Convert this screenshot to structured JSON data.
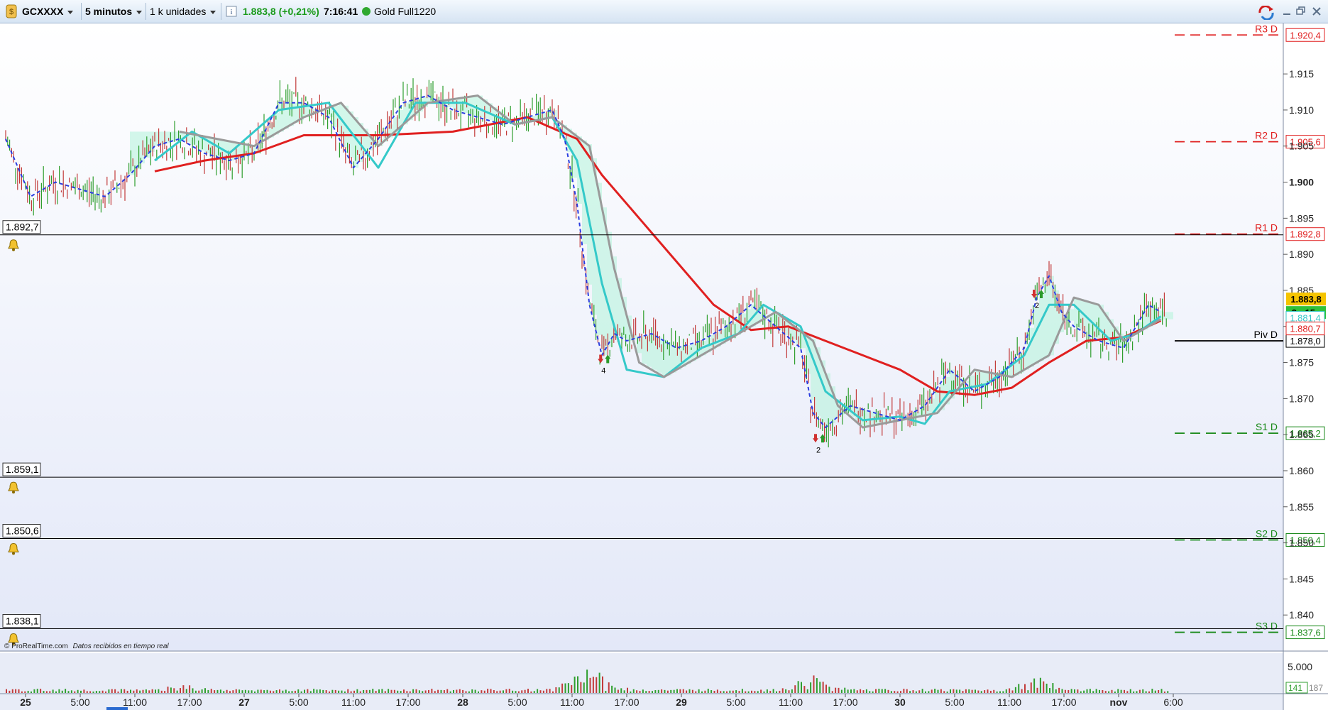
{
  "toolbar": {
    "symbol": "GCXXXX",
    "timeframe": "5 minutos",
    "units": "1 k unidades",
    "info_icon": "info-icon",
    "price_change": "1.883,8 (+0,21%)",
    "time": "7:16:41",
    "status_dot_color": "#2fa82f",
    "instrument_name": "Gold Full1220",
    "window_buttons": [
      "sync-icon",
      "minimize-icon",
      "restore-icon",
      "close-icon"
    ]
  },
  "price_axis": {
    "ticks": [
      {
        "value": 1915,
        "label": "1.915"
      },
      {
        "value": 1910,
        "label": "1.910"
      },
      {
        "value": 1905,
        "label": "1.905"
      },
      {
        "value": 1900,
        "label": "1.900"
      },
      {
        "value": 1895,
        "label": "1.895"
      },
      {
        "value": 1890,
        "label": "1.890"
      },
      {
        "value": 1885,
        "label": "1.885"
      },
      {
        "value": 1880,
        "label": "1.880"
      },
      {
        "value": 1875,
        "label": "1.875"
      },
      {
        "value": 1870,
        "label": "1.870"
      },
      {
        "value": 1865,
        "label": "1.865"
      },
      {
        "value": 1860,
        "label": "1.860"
      },
      {
        "value": 1855,
        "label": "1.855"
      },
      {
        "value": 1850,
        "label": "1.850"
      },
      {
        "value": 1845,
        "label": "1.845"
      },
      {
        "value": 1840,
        "label": "1.840"
      }
    ],
    "current_price": {
      "value": 1883.8,
      "label": "1.883,8",
      "bg": "#f5c400"
    },
    "countdown": {
      "label": "3m15s",
      "bg": "#2fc13a"
    },
    "ma_labels": [
      {
        "value": 1881.4,
        "label": "1.881,4",
        "color": "#35c9c9"
      },
      {
        "value": 1880.7,
        "label": "1.880,7",
        "color": "#e02020"
      }
    ]
  },
  "pivots": [
    {
      "name": "R3 D",
      "value": 1920.4,
      "label": "1.920,4",
      "color": "#e02020"
    },
    {
      "name": "R2 D",
      "value": 1905.6,
      "label": "1.905,6",
      "color": "#e02020"
    },
    {
      "name": "R1 D",
      "value": 1892.8,
      "label": "1.892,8",
      "color": "#e02020"
    },
    {
      "name": "Piv D",
      "value": 1878.0,
      "label": "1.878,0",
      "color": "#000000"
    },
    {
      "name": "S1 D",
      "value": 1865.2,
      "label": "1.865,2",
      "color": "#1a8a1a"
    },
    {
      "name": "S2 D",
      "value": 1850.4,
      "label": "1.850,4",
      "color": "#1a8a1a"
    },
    {
      "name": "S3 D",
      "value": 1837.6,
      "label": "1.837,6",
      "color": "#1a8a1a"
    }
  ],
  "alerts": [
    {
      "value": 1892.7,
      "label": "1.892,7",
      "icon": "bell-icon"
    },
    {
      "value": 1859.1,
      "label": "1.859,1",
      "icon": "bell-icon"
    },
    {
      "value": 1850.6,
      "label": "1.850,6",
      "icon": "bell-icon"
    },
    {
      "value": 1838.1,
      "label": "1.838,1",
      "icon": "bell-icon"
    }
  ],
  "signals": [
    {
      "x": 0.479,
      "price": 1875.5,
      "count": "4"
    },
    {
      "x": 0.652,
      "price": 1864.5,
      "count": "2"
    },
    {
      "x": 0.828,
      "price": 1884.5,
      "count": "2"
    }
  ],
  "time_axis": {
    "labels": [
      {
        "x": 0.0,
        "text": "25",
        "bold": true
      },
      {
        "x": 0.044,
        "text": "5:00"
      },
      {
        "x": 0.088,
        "text": "11:00"
      },
      {
        "x": 0.132,
        "text": "17:00"
      },
      {
        "x": 0.176,
        "text": "27",
        "bold": true
      },
      {
        "x": 0.22,
        "text": "5:00"
      },
      {
        "x": 0.264,
        "text": "11:00"
      },
      {
        "x": 0.308,
        "text": "17:00"
      },
      {
        "x": 0.352,
        "text": "28",
        "bold": true
      },
      {
        "x": 0.396,
        "text": "5:00"
      },
      {
        "x": 0.44,
        "text": "11:00"
      },
      {
        "x": 0.484,
        "text": "17:00"
      },
      {
        "x": 0.528,
        "text": "29",
        "bold": true
      },
      {
        "x": 0.572,
        "text": "5:00"
      },
      {
        "x": 0.616,
        "text": "11:00"
      },
      {
        "x": 0.66,
        "text": "17:00"
      },
      {
        "x": 0.704,
        "text": "30",
        "bold": true
      },
      {
        "x": 0.748,
        "text": "5:00"
      },
      {
        "x": 0.792,
        "text": "11:00"
      },
      {
        "x": 0.836,
        "text": "17:00"
      },
      {
        "x": 0.88,
        "text": "nov",
        "bold": true
      },
      {
        "x": 0.924,
        "text": "6:00"
      }
    ]
  },
  "volume_panel": {
    "axis_label": "5.000",
    "current_volume": "141",
    "current_volume_aux": "187"
  },
  "footer": {
    "copyright": "© ProRealTime.com",
    "realtime_note": "Datos recibidos en tiempo real"
  },
  "chart_data": {
    "type": "line",
    "title": "",
    "ylim": [
      1835,
      1922
    ],
    "x_span": [
      0,
      1
    ],
    "series": [
      {
        "name": "",
        "color": "#e02020",
        "points": [
          [
            0.12,
            1901.5
          ],
          [
            0.16,
            1903
          ],
          [
            0.2,
            1904
          ],
          [
            0.24,
            1906.5
          ],
          [
            0.3,
            1906.5
          ],
          [
            0.36,
            1907
          ],
          [
            0.42,
            1909
          ],
          [
            0.46,
            1906
          ],
          [
            0.48,
            1901
          ],
          [
            0.51,
            1895
          ],
          [
            0.53,
            1891
          ],
          [
            0.545,
            1888
          ],
          [
            0.57,
            1883
          ],
          [
            0.6,
            1879.5
          ],
          [
            0.63,
            1880
          ],
          [
            0.66,
            1878
          ],
          [
            0.69,
            1876
          ],
          [
            0.72,
            1874
          ],
          [
            0.75,
            1871
          ],
          [
            0.78,
            1870.5
          ],
          [
            0.81,
            1871.5
          ],
          [
            0.84,
            1875
          ],
          [
            0.87,
            1878
          ],
          [
            0.9,
            1878.5
          ],
          [
            0.93,
            1880.8
          ]
        ]
      },
      {
        "name": "",
        "color": "#35c9c9",
        "points": [
          [
            0.12,
            1903
          ],
          [
            0.15,
            1907
          ],
          [
            0.18,
            1904
          ],
          [
            0.22,
            1910
          ],
          [
            0.26,
            1911
          ],
          [
            0.3,
            1902
          ],
          [
            0.33,
            1911
          ],
          [
            0.37,
            1911
          ],
          [
            0.41,
            1908
          ],
          [
            0.44,
            1909
          ],
          [
            0.46,
            1903
          ],
          [
            0.48,
            1886
          ],
          [
            0.5,
            1874
          ],
          [
            0.53,
            1873
          ],
          [
            0.56,
            1877
          ],
          [
            0.59,
            1879
          ],
          [
            0.61,
            1883
          ],
          [
            0.64,
            1880
          ],
          [
            0.66,
            1871
          ],
          [
            0.69,
            1867
          ],
          [
            0.72,
            1867.5
          ],
          [
            0.74,
            1866.5
          ],
          [
            0.76,
            1871
          ],
          [
            0.79,
            1872
          ],
          [
            0.82,
            1876
          ],
          [
            0.84,
            1883
          ],
          [
            0.86,
            1883
          ],
          [
            0.89,
            1878
          ],
          [
            0.91,
            1879
          ],
          [
            0.93,
            1881.4
          ]
        ]
      },
      {
        "name": "",
        "color": "#9a9a9a",
        "points": [
          [
            0.14,
            1907
          ],
          [
            0.17,
            1906
          ],
          [
            0.2,
            1905
          ],
          [
            0.24,
            1909
          ],
          [
            0.27,
            1911
          ],
          [
            0.3,
            1905
          ],
          [
            0.34,
            1911
          ],
          [
            0.38,
            1912
          ],
          [
            0.41,
            1908
          ],
          [
            0.44,
            1909
          ],
          [
            0.47,
            1905
          ],
          [
            0.49,
            1888
          ],
          [
            0.51,
            1875
          ],
          [
            0.53,
            1873
          ],
          [
            0.56,
            1876
          ],
          [
            0.6,
            1880
          ],
          [
            0.62,
            1882
          ],
          [
            0.65,
            1878
          ],
          [
            0.67,
            1869
          ],
          [
            0.69,
            1866
          ],
          [
            0.72,
            1867
          ],
          [
            0.75,
            1868
          ],
          [
            0.78,
            1874
          ],
          [
            0.81,
            1873
          ],
          [
            0.84,
            1876
          ],
          [
            0.86,
            1884
          ],
          [
            0.88,
            1883
          ],
          [
            0.9,
            1878
          ],
          [
            0.93,
            1881
          ]
        ]
      },
      {
        "name": "",
        "color": "#2a3de0",
        "dashed": true,
        "points": [
          [
            0.0,
            1906
          ],
          [
            0.02,
            1898
          ],
          [
            0.04,
            1900
          ],
          [
            0.06,
            1899
          ],
          [
            0.08,
            1898
          ],
          [
            0.1,
            1901
          ],
          [
            0.12,
            1905
          ],
          [
            0.14,
            1906
          ],
          [
            0.16,
            1904
          ],
          [
            0.18,
            1903
          ],
          [
            0.2,
            1904
          ],
          [
            0.22,
            1911
          ],
          [
            0.24,
            1911
          ],
          [
            0.26,
            1909
          ],
          [
            0.28,
            1902
          ],
          [
            0.3,
            1906
          ],
          [
            0.32,
            1911
          ],
          [
            0.34,
            1912
          ],
          [
            0.36,
            1910
          ],
          [
            0.38,
            1909
          ],
          [
            0.4,
            1908
          ],
          [
            0.42,
            1909
          ],
          [
            0.44,
            1910
          ],
          [
            0.45,
            1906
          ],
          [
            0.46,
            1897
          ],
          [
            0.47,
            1883
          ],
          [
            0.48,
            1876
          ],
          [
            0.49,
            1879
          ],
          [
            0.5,
            1878
          ],
          [
            0.52,
            1879
          ],
          [
            0.54,
            1877
          ],
          [
            0.56,
            1878
          ],
          [
            0.58,
            1880
          ],
          [
            0.6,
            1883
          ],
          [
            0.62,
            1880
          ],
          [
            0.64,
            1877
          ],
          [
            0.65,
            1868
          ],
          [
            0.66,
            1866
          ],
          [
            0.68,
            1869
          ],
          [
            0.7,
            1868
          ],
          [
            0.72,
            1867
          ],
          [
            0.74,
            1869
          ],
          [
            0.76,
            1874
          ],
          [
            0.78,
            1871
          ],
          [
            0.8,
            1873
          ],
          [
            0.82,
            1877
          ],
          [
            0.83,
            1884
          ],
          [
            0.84,
            1887
          ],
          [
            0.85,
            1882
          ],
          [
            0.86,
            1880
          ],
          [
            0.88,
            1878
          ],
          [
            0.9,
            1877
          ],
          [
            0.92,
            1883
          ],
          [
            0.93,
            1882
          ]
        ]
      }
    ]
  }
}
